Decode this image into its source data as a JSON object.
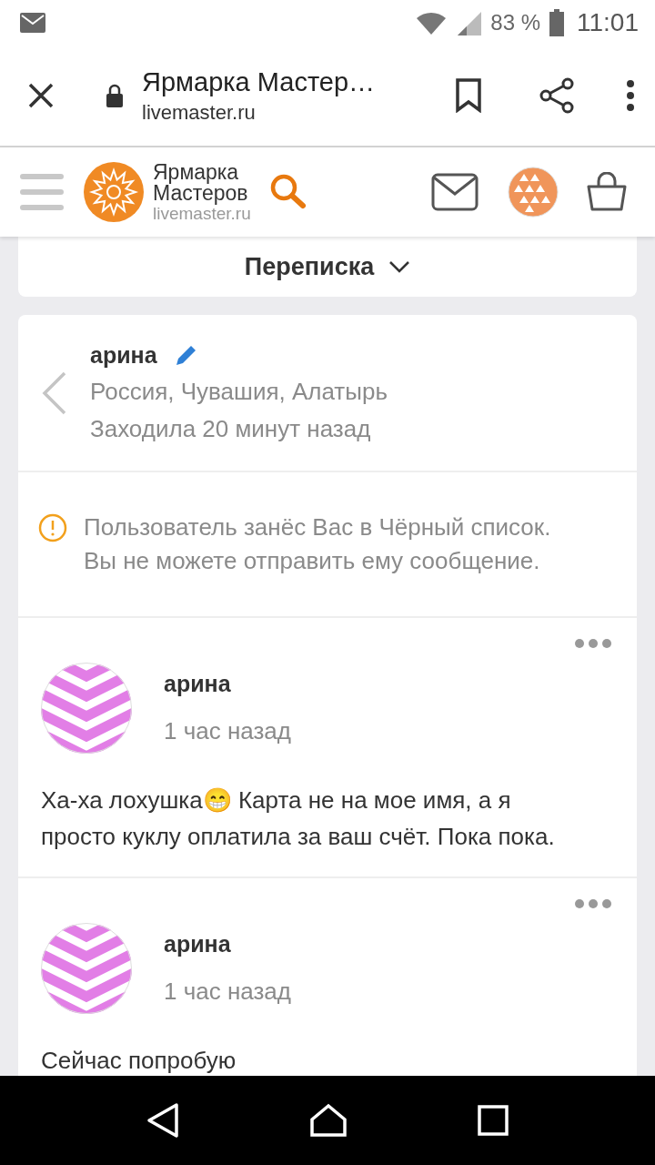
{
  "status_bar": {
    "battery": "83 %",
    "time": "11:01"
  },
  "browser_bar": {
    "title": "Ярмарка Мастер…",
    "url": "livemaster.ru"
  },
  "site_header": {
    "logo_line1": "Ярмарка",
    "logo_line2": "Мастеров",
    "logo_domain": "livemaster.ru"
  },
  "section": {
    "title": "Переписка"
  },
  "contact": {
    "name": "арина",
    "location": "Россия, Чувашия, Алатырь",
    "last_seen": "Заходила 20 минут назад"
  },
  "notice": {
    "text": "Пользователь занёс Вас в Чёрный список. Вы не можете отправить ему сообщение."
  },
  "messages": [
    {
      "author": "арина",
      "time": "1 час назад",
      "text": "Ха-ха лохушка😁 Карта не на мое имя, а я просто куклу оплатила за ваш счёт. Пока пока."
    },
    {
      "author": "арина",
      "time": "1 час назад",
      "text": "Сейчас попробую"
    }
  ]
}
